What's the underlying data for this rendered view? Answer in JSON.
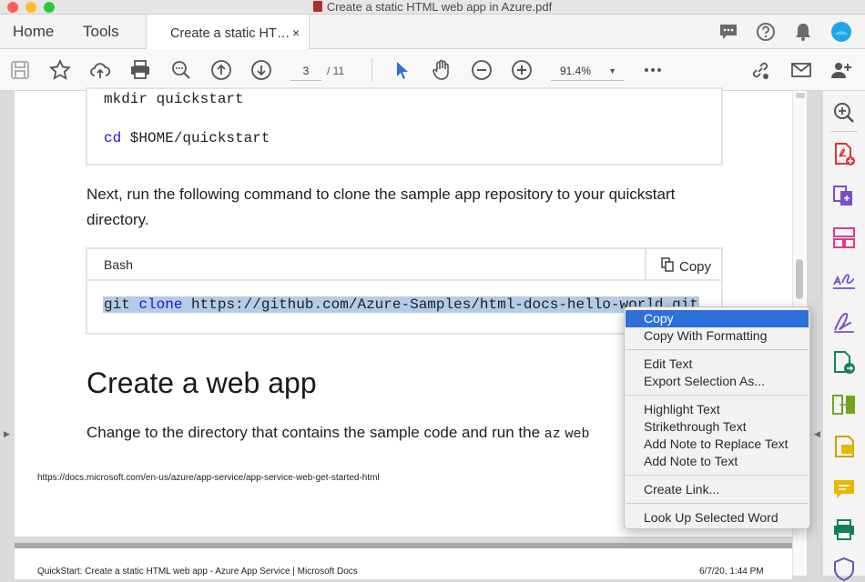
{
  "window": {
    "title": "Create a static HTML web app in Azure.pdf"
  },
  "tabs": {
    "home": "Home",
    "tools": "Tools",
    "document": "Create a static HT…",
    "close": "×"
  },
  "toolbar": {
    "page_current": "3",
    "page_total": "/ 11",
    "zoom": "91.4%"
  },
  "doc": {
    "code1_line1": "mkdir quickstart",
    "code1_kw": "cd",
    "code1_line2_rest": " $HOME/quickstart",
    "para1_line1": "Next, run the following command to clone the sample app repository to your quickstart",
    "para1_line2": "directory.",
    "code2_lang": "Bash",
    "code2_copy": "Copy",
    "code2_cmd": "git",
    "code2_kw": "clone",
    "code2_url": "https://github.com/Azure-Samples/html-docs-hello-world.git",
    "heading": "Create a web app",
    "para2_text": "Change to the directory that contains the sample code and run the",
    "para2_code": "az",
    "para2_tail": "web",
    "footer_url": "https://docs.microsoft.com/en-us/azure/app-service/app-service-web-get-started-html",
    "page2_title": "QuickStart: Create a static HTML web app - Azure App Service | Microsoft Docs",
    "page2_date": "6/7/20, 1:44 PM"
  },
  "context_menu": {
    "items": [
      "Copy",
      "Copy With Formatting",
      "Edit Text",
      "Export Selection As...",
      "Highlight Text",
      "Strikethrough Text",
      "Add Note to Replace Text",
      "Add Note to Text",
      "Create Link...",
      "Look Up Selected Word"
    ]
  },
  "colors": {
    "accent": "#2f6fd9",
    "keyword": "#1717d6",
    "selection": "#b4cce6"
  }
}
